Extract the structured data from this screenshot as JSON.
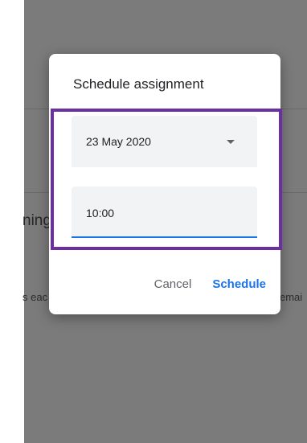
{
  "background": {
    "heading_fragment": "ning",
    "text_fragment_left": "s eac",
    "text_fragment_right": "emai"
  },
  "dialog": {
    "title": "Schedule assignment",
    "date_field": {
      "value": "23 May 2020",
      "icon": "dropdown-arrow-icon"
    },
    "time_field": {
      "value": "10:00"
    },
    "actions": {
      "cancel_label": "Cancel",
      "schedule_label": "Schedule"
    }
  },
  "colors": {
    "backdrop": "#7b7b7b",
    "accent": "#1a73e8",
    "highlight": "#6a2fa0",
    "field_bg": "#f1f3f4"
  }
}
